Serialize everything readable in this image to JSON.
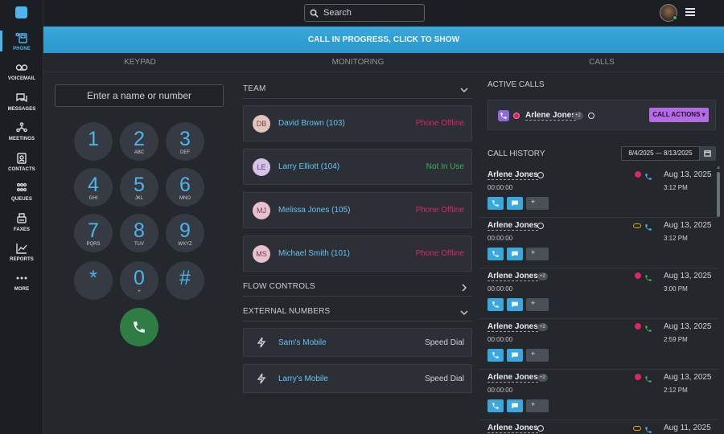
{
  "nav": {
    "items": [
      {
        "label": "PHONE",
        "icon": "phone-icon"
      },
      {
        "label": "VOICEMAIL",
        "icon": "voicemail-icon"
      },
      {
        "label": "MESSAGES",
        "icon": "messages-icon"
      },
      {
        "label": "MEETINGS",
        "icon": "meetings-icon"
      },
      {
        "label": "CONTACTS",
        "icon": "contacts-icon"
      },
      {
        "label": "QUEUES",
        "icon": "queues-icon"
      },
      {
        "label": "FAXES",
        "icon": "fax-icon"
      },
      {
        "label": "REPORTS",
        "icon": "reports-icon"
      },
      {
        "label": "MORE",
        "icon": "more-icon"
      }
    ]
  },
  "topbar": {
    "search_placeholder": "Search"
  },
  "banner": {
    "text": "CALL IN PROGRESS, CLICK TO SHOW"
  },
  "tabs": [
    "KEYPAD",
    "MONITORING",
    "CALLS"
  ],
  "keypad": {
    "input_placeholder": "Enter a name or number",
    "keys": [
      {
        "digit": "1",
        "sub": ""
      },
      {
        "digit": "2",
        "sub": "ABC"
      },
      {
        "digit": "3",
        "sub": "DEF"
      },
      {
        "digit": "4",
        "sub": "GHI"
      },
      {
        "digit": "5",
        "sub": "JKL"
      },
      {
        "digit": "6",
        "sub": "MNO"
      },
      {
        "digit": "7",
        "sub": "PQRS"
      },
      {
        "digit": "8",
        "sub": "TUV"
      },
      {
        "digit": "9",
        "sub": "WXYZ"
      },
      {
        "digit": "*",
        "sub": ""
      },
      {
        "digit": "0",
        "sub": "+"
      },
      {
        "digit": "#",
        "sub": ""
      }
    ]
  },
  "team": {
    "title": "TEAM",
    "members": [
      {
        "initials": "DB",
        "name": "David Brown (103)",
        "status": "Phone Offline"
      },
      {
        "initials": "LE",
        "name": "Larry Elliott (104)",
        "status": "Not In Use"
      },
      {
        "initials": "MJ",
        "name": "Melissa Jones (105)",
        "status": "Phone Offline"
      },
      {
        "initials": "MS",
        "name": "Michael Smith (101)",
        "status": "Phone Offline"
      }
    ]
  },
  "flow_controls": {
    "title": "FLOW CONTROLS"
  },
  "external_numbers": {
    "title": "EXTERNAL NUMBERS",
    "items": [
      {
        "name": "Sam's Mobile",
        "type": "Speed Dial"
      },
      {
        "name": "Larry's Mobile",
        "type": "Speed Dial"
      }
    ]
  },
  "active_calls": {
    "title": "ACTIVE CALLS",
    "call": {
      "name": "Arlene Jones",
      "badge": "+2",
      "actions_label": "CALL ACTIONS ▾"
    }
  },
  "call_history": {
    "title": "CALL HISTORY",
    "date_range": "8/4/2025 — 8/13/2025",
    "entries": [
      {
        "name": "Arlene Jones",
        "badge": "",
        "duration": "00:00:00",
        "date": "Aug 13, 2025",
        "time": "3:12 PM",
        "status": "missed"
      },
      {
        "name": "Arlene Jones",
        "badge": "",
        "duration": "00:00:00",
        "date": "Aug 13, 2025",
        "time": "3:12 PM",
        "status": "voicemail"
      },
      {
        "name": "Arlene Jones",
        "badge": "+2",
        "duration": "00:00:00",
        "date": "Aug 13, 2025",
        "time": "3:00 PM",
        "status": "missed"
      },
      {
        "name": "Arlene Jones",
        "badge": "+2",
        "duration": "00:00:00",
        "date": "Aug 13, 2025",
        "time": "2:59 PM",
        "status": "missed"
      },
      {
        "name": "Arlene Jones",
        "badge": "+2",
        "duration": "00:00:00",
        "date": "Aug 13, 2025",
        "time": "2:12 PM",
        "status": "missed"
      },
      {
        "name": "Arlene Jones",
        "badge": "",
        "duration": "",
        "date": "Aug 11, 2025",
        "time": "",
        "status": "voicemail"
      }
    ],
    "db_button_label": "+"
  },
  "colors": {
    "accent": "#4cb6ea",
    "offline": "#d72860",
    "available": "#3fae5c",
    "call_actions": "#b56ae8",
    "call_button": "#2f7d44"
  }
}
